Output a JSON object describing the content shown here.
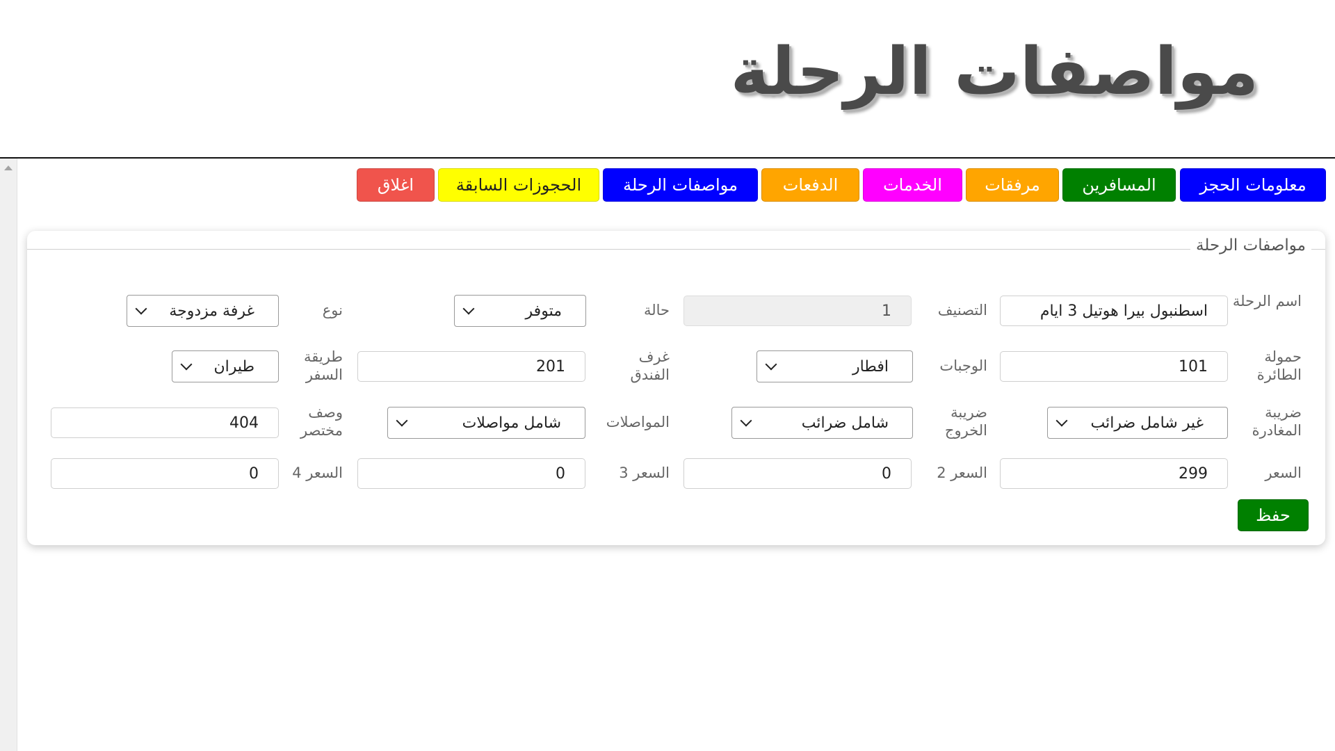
{
  "page": {
    "title": "مواصفات الرحلة"
  },
  "nav": {
    "booking_info": "معلومات الحجز",
    "travelers": "المسافرين",
    "attachments": "مرفقات",
    "services": "الخدمات",
    "payments": "الدفعات",
    "trip_specs": "مواصفات الرحلة",
    "previous_bookings": "الحجوزات السابقة",
    "close": "اغلاق"
  },
  "colors": {
    "booking_info": "#0000ff",
    "travelers": "#008000",
    "attachments": "#ffa500",
    "services": "#ff00ff",
    "payments": "#ffa500",
    "trip_specs": "#0000ff",
    "previous_bookings": "#ffff00",
    "close": "#f0544c",
    "save": "#008000"
  },
  "form": {
    "legend": "مواصفات الرحلة",
    "trip_name": {
      "label": "اسم الرحلة",
      "value": "اسطنبول بيرا هوتيل 3 ايام"
    },
    "classification": {
      "label": "التصنيف",
      "value": "1"
    },
    "status": {
      "label": "حالة",
      "value": "متوفر"
    },
    "type": {
      "label": "نوع",
      "value": "غرفة مزدوجة"
    },
    "plane_capacity": {
      "label": "حمولة الطائرة",
      "value": "101"
    },
    "meals": {
      "label": "الوجبات",
      "value": "افطار"
    },
    "hotel_rooms": {
      "label": "غرف الفندق",
      "value": "201"
    },
    "travel_method": {
      "label": "طريقة السفر",
      "value": "طيران"
    },
    "departure_tax": {
      "label": "ضريبة المغادرة",
      "value": "غير شامل ضرائب"
    },
    "exit_tax": {
      "label": "ضريبة الخروج",
      "value": "شامل ضرائب"
    },
    "transport": {
      "label": "المواصلات",
      "value": "شامل مواصلات"
    },
    "short_desc": {
      "label": "وصف مختصر",
      "value": "404"
    },
    "price": {
      "label": "السعر",
      "value": "299"
    },
    "price2": {
      "label": "السعر 2",
      "value": "0"
    },
    "price3": {
      "label": "السعر 3",
      "value": "0"
    },
    "price4": {
      "label": "السعر 4",
      "value": "0"
    },
    "save": "حفظ"
  }
}
